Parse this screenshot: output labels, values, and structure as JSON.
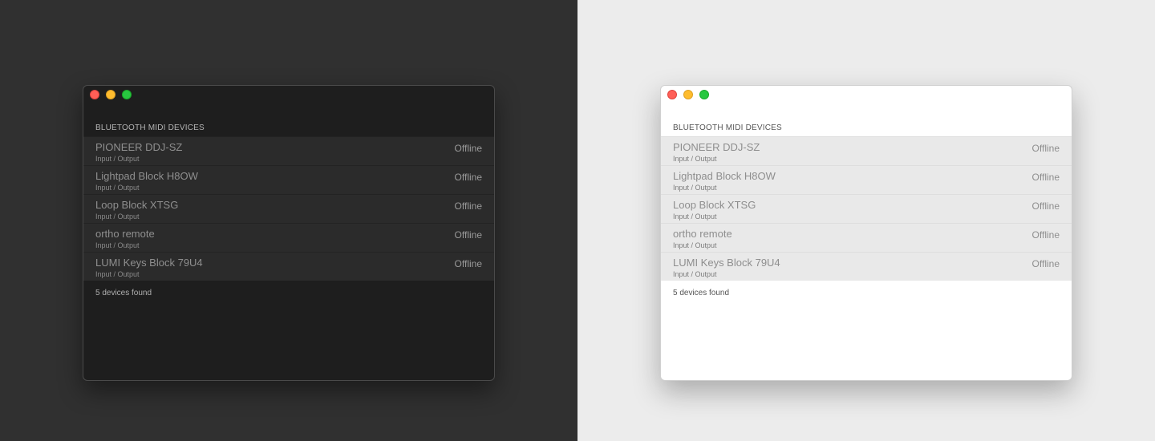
{
  "section_header": "BLUETOOTH MIDI DEVICES",
  "devices": [
    {
      "name": "PIONEER DDJ-SZ",
      "type": "Input / Output",
      "status": "Offline"
    },
    {
      "name": "Lightpad Block H8OW",
      "type": "Input / Output",
      "status": "Offline"
    },
    {
      "name": "Loop Block XTSG",
      "type": "Input / Output",
      "status": "Offline"
    },
    {
      "name": "ortho remote",
      "type": "Input / Output",
      "status": "Offline"
    },
    {
      "name": "LUMI Keys Block 79U4",
      "type": "Input / Output",
      "status": "Offline"
    }
  ],
  "footer": "5 devices found",
  "colors": {
    "close": "#ff5f57",
    "minimize": "#febc2e",
    "maximize": "#28c840",
    "dark_background": "#303030",
    "light_background": "#ececec"
  }
}
